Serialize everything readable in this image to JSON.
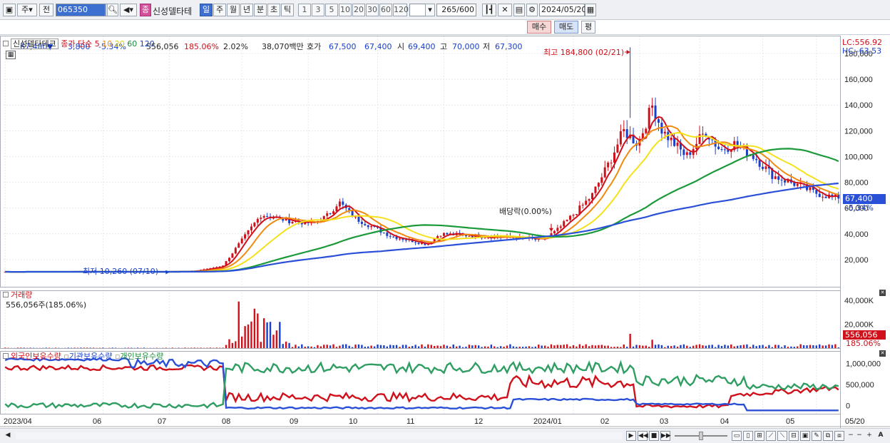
{
  "toolbar": {
    "mode": "주",
    "prev_label": "전",
    "code": "065350",
    "indicator_badge": "종",
    "stock_name": "신성델타테",
    "period_tabs": [
      "일",
      "주",
      "월",
      "년",
      "분",
      "초",
      "틱"
    ],
    "active_period": "일",
    "intervals": [
      "1",
      "3",
      "5",
      "10",
      "20",
      "30",
      "60",
      "120"
    ],
    "count": "265",
    "count_total": "/600",
    "date": "2024/05/20"
  },
  "quote": {
    "price": "67,400",
    "arrow": "▼",
    "change": "3,800",
    "change_pct": "-5.34%",
    "volume": "556,056",
    "vol_ratio": "185.06%",
    "turnover": "2.02%",
    "amount": "38,070백만",
    "ask_label": "호가",
    "ask": "67,500",
    "bid": "67,400",
    "open_label": "시",
    "open": "69,400",
    "high_label": "고",
    "high": "70,000",
    "low_label": "저",
    "low": "67,300",
    "buy_label": "매수",
    "sell_label": "매도",
    "eval_label": "평"
  },
  "price_panel": {
    "name": "신성델타테크",
    "ma_title": "종가 단순",
    "ma_periods": [
      "5",
      "10",
      "20",
      "60",
      "120"
    ],
    "lc": "LC:556.92",
    "hc": "HC:-63.53",
    "y_ticks": [
      "180,000",
      "160,000",
      "140,000",
      "120,000",
      "100,000",
      "80,000",
      "60,000",
      "40,000",
      "20,000"
    ],
    "current_label": "67,400",
    "current_pct": "-5.34%",
    "high_annotation": "최고 184,800 (02/21)",
    "low_annotation": "최저 10,260 (07/10)",
    "dividend_annotation": "배당락(0.00%)"
  },
  "volume_panel": {
    "title": "거래량",
    "value_label": "556,056주(185.06%)",
    "y_ticks": [
      "40,000K",
      "20,000K"
    ],
    "current_label": "556,056",
    "current_pct": "185.06%"
  },
  "holding_panel": {
    "series": [
      "외국인보유수량",
      "기관보유수량",
      "개인보유수량"
    ],
    "y_ticks": [
      "1,000,000",
      "500,000",
      "0"
    ]
  },
  "x_labels": [
    "2023/04",
    "06",
    "07",
    "08",
    "09",
    "10",
    "11",
    "12",
    "2024/01",
    "02",
    "03",
    "04",
    "05",
    "05/20"
  ],
  "colors": {
    "ma5": "#d0101a",
    "ma10": "#f08a10",
    "ma20": "#f5e11a",
    "ma60": "#1a9a3a",
    "ma120": "#2a50d8",
    "up": "#d0101a",
    "down": "#1a40c8",
    "foreign": "#d0101a",
    "inst": "#2a50d8",
    "indiv": "#2e9e62"
  },
  "chart_data": [
    {
      "type": "line",
      "title": "신성델타테크 일봉",
      "x": [
        "2023/04",
        "2023/06",
        "2023/07",
        "2023/08",
        "2023/09",
        "2023/10",
        "2023/11",
        "2023/12",
        "2024/01",
        "2024/02",
        "2024/03",
        "2024/04",
        "2024/05"
      ],
      "series": [
        {
          "name": "종가",
          "values": [
            10500,
            10600,
            11000,
            36000,
            52000,
            60000,
            33000,
            40000,
            40000,
            115000,
            105000,
            100000,
            67400
          ]
        }
      ],
      "ylim": [
        0,
        185000
      ],
      "high": 184800,
      "low": 10260
    },
    {
      "type": "bar",
      "title": "거래량",
      "y_unit": "K",
      "ylim": [
        0,
        40000
      ]
    },
    {
      "type": "line",
      "title": "보유수량",
      "series": [
        {
          "name": "외국인보유수량"
        },
        {
          "name": "기관보유수량"
        },
        {
          "name": "개인보유수량"
        }
      ],
      "ylim": [
        -200000,
        1300000
      ]
    }
  ]
}
